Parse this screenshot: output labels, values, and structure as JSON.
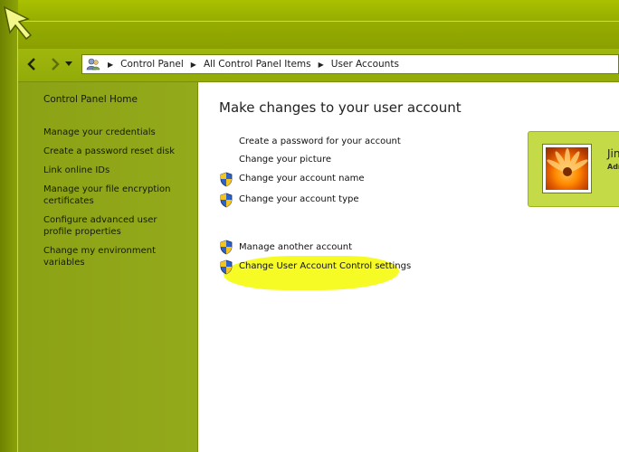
{
  "breadcrumb": {
    "items": [
      "Control Panel",
      "All Control Panel Items",
      "User Accounts"
    ]
  },
  "sidebar": {
    "home": "Control Panel Home",
    "links": [
      "Manage your credentials",
      "Create a password reset disk",
      "Link online IDs",
      "Manage your file encryption certificates",
      "Configure advanced user profile properties",
      "Change my environment variables"
    ]
  },
  "main": {
    "title": "Make changes to your user account",
    "tasks": [
      {
        "label": "Create a password for your account",
        "shield": false
      },
      {
        "label": "Change your picture",
        "shield": false
      },
      {
        "label": "Change your account name",
        "shield": true
      },
      {
        "label": "Change your account type",
        "shield": true
      }
    ],
    "other_tasks": [
      {
        "label": "Manage another account",
        "shield": true
      },
      {
        "label": "Change User Account Control settings",
        "shield": true
      }
    ]
  },
  "user": {
    "name": "Jin",
    "role": "Adm"
  },
  "icons": {
    "back": "back-arrow-icon",
    "forward": "forward-arrow-icon",
    "recent": "chevron-down-icon",
    "address": "user-accounts-icon",
    "shield": "uac-shield-icon",
    "cursor": "mouse-cursor-icon"
  },
  "colors": {
    "theme_green": "#8ea516",
    "highlight": "#f6fb1a",
    "tile": "#c4da47"
  }
}
